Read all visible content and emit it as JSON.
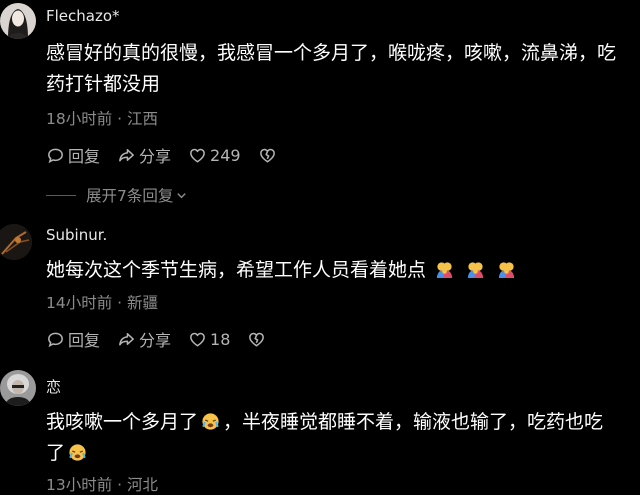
{
  "comments": [
    {
      "username": "Flechazo*",
      "text": "感冒好的真的很慢，我感冒一个多月了，喉咙疼，咳嗽，流鼻涕，吃药打针都没用",
      "time": "18小时前",
      "location": "江西",
      "reply_label": "回复",
      "share_label": "分享",
      "likes": "249",
      "expand_label": "展开7条回复"
    },
    {
      "username": "Subinur.",
      "text": "她每次这个季节生病，希望工作人员看着她点",
      "time": "14小时前",
      "location": "新疆",
      "reply_label": "回复",
      "share_label": "分享",
      "likes": "18"
    },
    {
      "username": "恋",
      "text_part1": "我咳嗽一个多月了",
      "text_part2": "，半夜睡觉都睡不着，输液也输了，吃药也吃了",
      "time": "13小时前",
      "location": "河北"
    }
  ],
  "separator": " · ",
  "icons": {
    "reply": "reply-bubble-icon",
    "share": "share-arrow-icon",
    "like": "heart-icon",
    "dislike": "broken-heart-icon",
    "expand": "chevron-down-icon",
    "emoji_couple": "couple-hug-emoji",
    "emoji_cry": "crying-face-emoji"
  },
  "colors": {
    "background": "#000000",
    "text": "#ffffff",
    "meta": "#8c8c8c",
    "action": "#b4b4b4"
  }
}
